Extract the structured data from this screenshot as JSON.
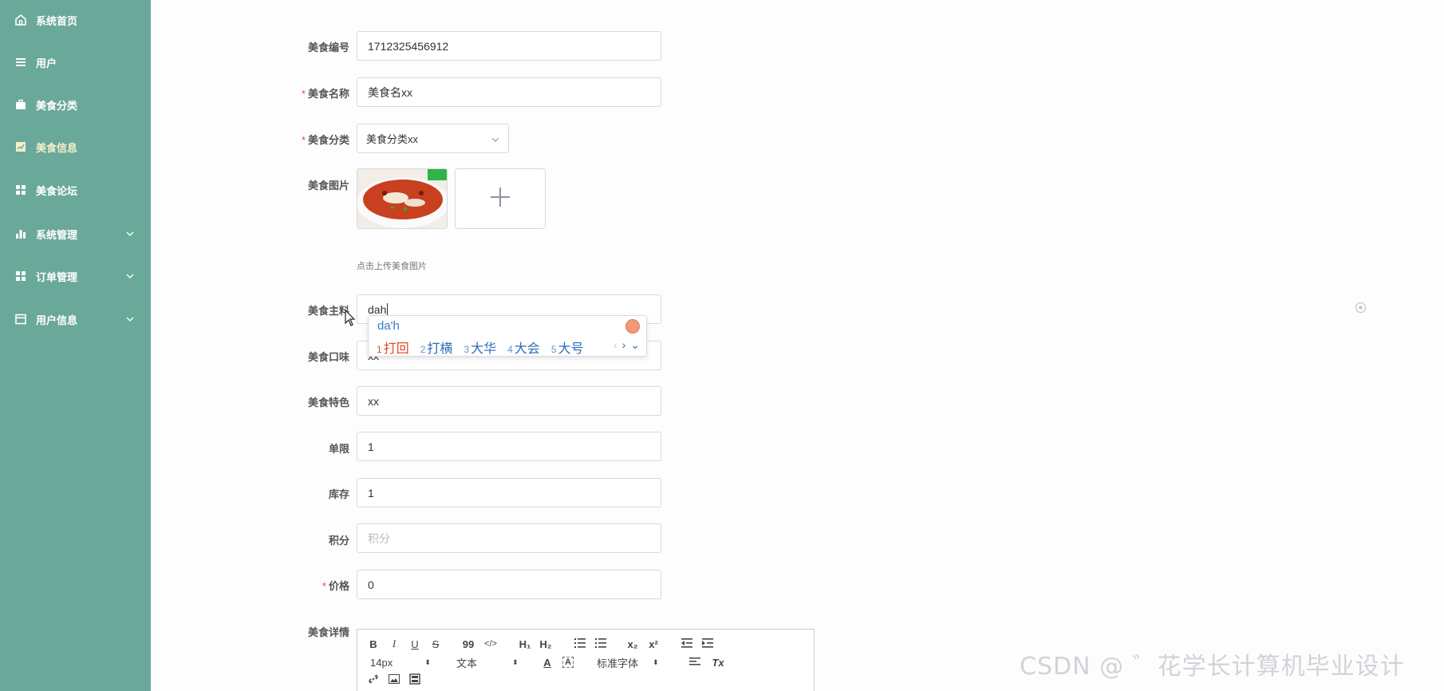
{
  "sidebar": {
    "items": [
      {
        "label": "系统首页",
        "icon": "home-icon",
        "has_chevron": false
      },
      {
        "label": "用户",
        "icon": "list-icon",
        "has_chevron": false
      },
      {
        "label": "美食分类",
        "icon": "briefcase-icon",
        "has_chevron": false
      },
      {
        "label": "美食信息",
        "icon": "chart-card-icon",
        "has_chevron": false,
        "active": true
      },
      {
        "label": "美食论坛",
        "icon": "grid-icon",
        "has_chevron": false
      },
      {
        "label": "系统管理",
        "icon": "bar-chart-icon",
        "has_chevron": true
      },
      {
        "label": "订单管理",
        "icon": "grid-icon",
        "has_chevron": true
      },
      {
        "label": "用户信息",
        "icon": "window-icon",
        "has_chevron": true
      }
    ]
  },
  "form": {
    "food_id": {
      "label": "美食编号",
      "value": "1712325456912"
    },
    "food_name": {
      "label": "美食名称",
      "required": true,
      "value": "美食名xx"
    },
    "food_category": {
      "label": "美食分类",
      "required": true,
      "value": "美食分类xx"
    },
    "food_image": {
      "label": "美食图片",
      "hint": "点击上传美食图片"
    },
    "ingredients": {
      "label": "美食主料",
      "value": "dah"
    },
    "taste": {
      "label": "美食口味",
      "value": "xx"
    },
    "feature": {
      "label": "美食特色",
      "value": "xx"
    },
    "limit": {
      "label": "单限",
      "value": "1"
    },
    "stock": {
      "label": "库存",
      "value": "1"
    },
    "points": {
      "label": "积分",
      "placeholder": "积分",
      "value": ""
    },
    "price": {
      "label": "价格",
      "required": true,
      "value": "0"
    },
    "details": {
      "label": "美食详情"
    }
  },
  "ime": {
    "composition": "da'h",
    "candidates": [
      {
        "num": "1",
        "text": "打回"
      },
      {
        "num": "2",
        "text": "打横"
      },
      {
        "num": "3",
        "text": "大华"
      },
      {
        "num": "4",
        "text": "大会"
      },
      {
        "num": "5",
        "text": "大号"
      }
    ]
  },
  "editor_toolbar": {
    "bold": "B",
    "italic": "I",
    "underline": "U",
    "strike": "S",
    "quote": "99",
    "code": "</>",
    "h1": "H₁",
    "h2": "H₂",
    "sub": "x₂",
    "sup": "x²",
    "font_size": "14px",
    "paragraph": "文本",
    "font_family": "标准字体",
    "clear": "Tx"
  },
  "watermark": "CSDN @ ゛花学长计算机毕业设计",
  "colors": {
    "sidebar": "#6aa89a",
    "required": "#e8494a",
    "ime_blue": "#2f6db8",
    "ime_red": "#e24a2b"
  }
}
